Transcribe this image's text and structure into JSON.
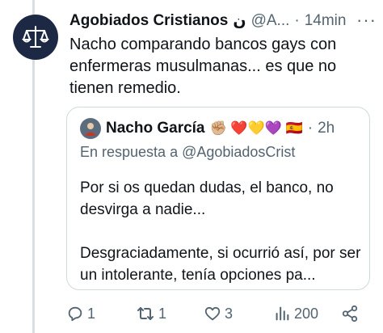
{
  "colors": {
    "text": "#0f1419",
    "muted": "#536471",
    "border": "#cfd9de",
    "thread_line": "#d9dee2"
  },
  "tweet": {
    "author_name": "Agobiados Cristianos",
    "name_suffix": "ن",
    "handle": "@A...",
    "separator": "·",
    "time": "14min",
    "more_label": "···",
    "text": "Nacho comparando bancos gays con enfermeras musulmanas... es que no tienen remedio."
  },
  "quote": {
    "author_name": "Nacho García",
    "name_emojis": "✊🏼 ❤️💛💜 🇪🇸",
    "separator": "·",
    "time": "2h",
    "reply_to": "En respuesta a @AgobiadosCrist",
    "paragraph1": "Por si os quedan dudas, el banco, no desvirga a nadie...",
    "paragraph2": "Desgraciadamente, si ocurrió así, por ser un intolerante, tenía opciones pa..."
  },
  "actions": {
    "replies": "1",
    "retweets": "1",
    "likes": "3",
    "views": "200"
  },
  "icons": [
    "scales-of-justice-icon",
    "reply-icon",
    "retweet-icon",
    "heart-icon",
    "views-icon",
    "share-icon"
  ]
}
